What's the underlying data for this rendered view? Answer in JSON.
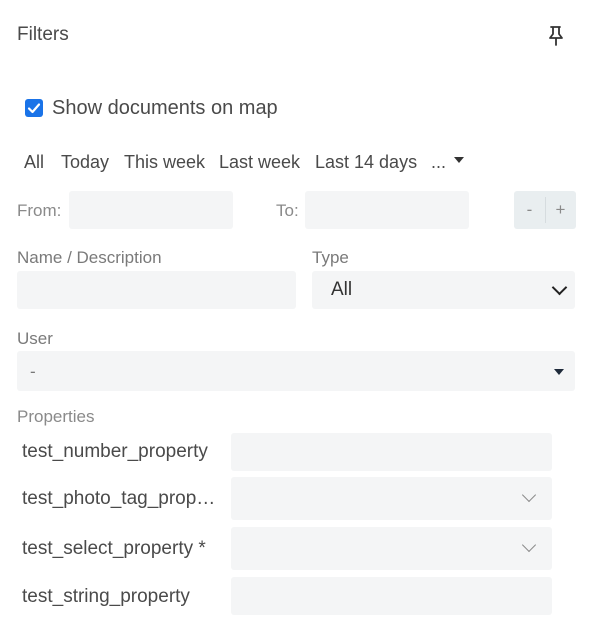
{
  "header": {
    "title": "Filters",
    "pin_icon": "pin-icon"
  },
  "map_toggle": {
    "label": "Show documents on map",
    "checked": true,
    "color": "#1a73e8"
  },
  "quick_ranges": {
    "items": [
      "All",
      "Today",
      "This week",
      "Last week",
      "Last 14 days"
    ],
    "more_label": "..."
  },
  "date_range": {
    "from_label": "From:",
    "from_value": "",
    "to_label": "To:",
    "to_value": "",
    "minus_label": "-",
    "plus_label": "+"
  },
  "name_filter": {
    "label": "Name / Description",
    "value": ""
  },
  "type_filter": {
    "label": "Type",
    "selected": "All"
  },
  "user_filter": {
    "label": "User",
    "selected": "-"
  },
  "properties": {
    "label": "Properties",
    "items": [
      {
        "name": "test_number_property",
        "value": "",
        "kind": "input"
      },
      {
        "name": "test_photo_tag_prop…",
        "value": "",
        "kind": "select"
      },
      {
        "name": "test_select_property *",
        "value": "",
        "kind": "select"
      },
      {
        "name": "test_string_property",
        "value": "",
        "kind": "input"
      }
    ]
  }
}
